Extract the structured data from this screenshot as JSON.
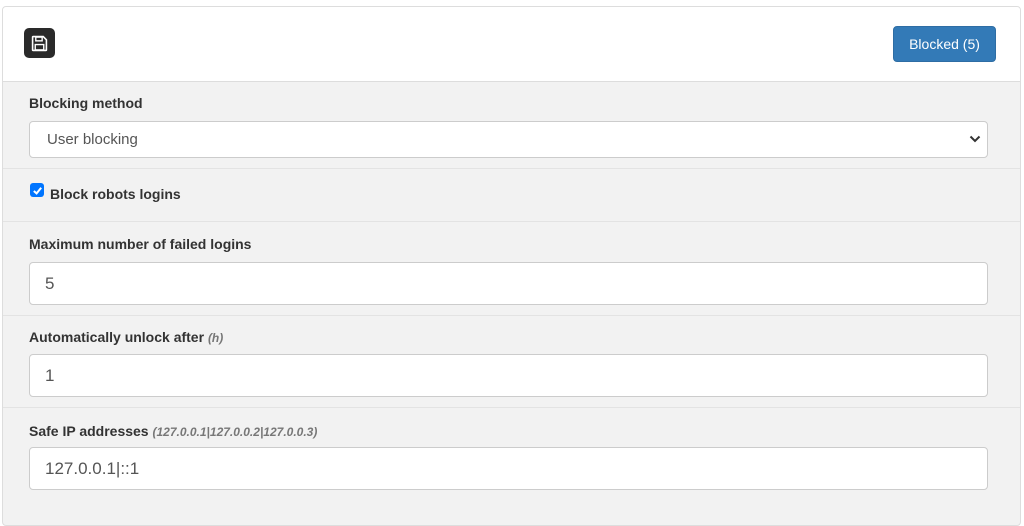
{
  "toolbar": {
    "save_icon": "floppy-disk-icon",
    "blocked_label": "Blocked (5)"
  },
  "blocking_method": {
    "label": "Blocking method",
    "selected": "User blocking"
  },
  "block_robots": {
    "label": "Block robots logins",
    "checked": true
  },
  "max_failed": {
    "label": "Maximum number of failed logins",
    "value": "5"
  },
  "unlock_after": {
    "label": "Automatically unlock after",
    "hint": "(h)",
    "value": "1"
  },
  "safe_ips": {
    "label": "Safe IP addresses",
    "hint": "(127.0.0.1|127.0.0.2|127.0.0.3)",
    "value": "127.0.0.1|::1"
  },
  "colors": {
    "primary": "#337ab7",
    "panel_bg": "#f2f2f2",
    "checkbox": "#0075ff"
  }
}
